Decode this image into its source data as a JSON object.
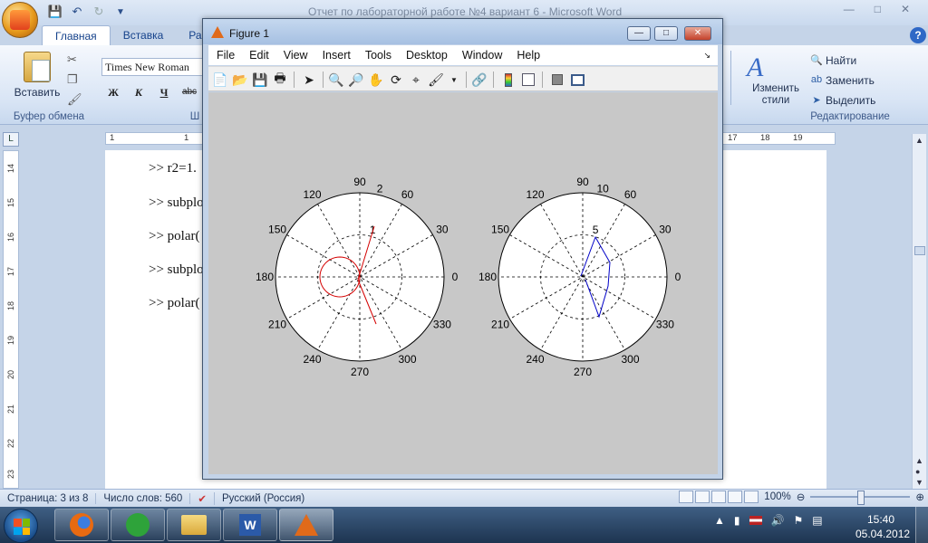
{
  "word": {
    "title": "Отчет по лабораторной работе №4 вариант 6  -  Microsoft Word",
    "tabs": [
      "Главная",
      "Вставка",
      "Разм"
    ],
    "font_name": "Times New Roman",
    "paste_label": "Вставить",
    "group_clipboard": "Буфер обмена",
    "group_font": "Ш",
    "styles_label": "Изменить стили",
    "find": "Найти",
    "replace": "Заменить",
    "select": "Выделить",
    "group_edit": "Редактирование",
    "format_buttons": [
      "Ж",
      "К",
      "Ч",
      "abc"
    ],
    "ruler_left": [
      "1",
      "1"
    ],
    "ruler_right": [
      "17",
      "18",
      "19"
    ],
    "vruler": [
      "14",
      "15",
      "16",
      "17",
      "18",
      "19",
      "20",
      "21",
      "22",
      "23"
    ],
    "doc_lines": [
      ">> r2=1.",
      ">> subplo",
      ">> polar(",
      ">> subplo",
      ">> polar("
    ]
  },
  "status": {
    "page": "Страница: 3 из 8",
    "words": "Число слов: 560",
    "language": "Русский (Россия)",
    "zoom": "100%"
  },
  "clock": {
    "time": "15:40",
    "date": "05.04.2012"
  },
  "figure": {
    "title": "Figure 1",
    "menu": [
      "File",
      "Edit",
      "View",
      "Insert",
      "Tools",
      "Desktop",
      "Window",
      "Help"
    ]
  },
  "polar_plots": [
    {
      "rmax": 2,
      "ring_labels": [
        "1",
        "2"
      ],
      "angle_labels": [
        "0",
        "30",
        "60",
        "90",
        "120",
        "150",
        "180",
        "210",
        "240",
        "270",
        "300",
        "330"
      ],
      "color": "#d40000",
      "curve": "circle-and-line"
    },
    {
      "rmax": 10,
      "ring_labels": [
        "5",
        "10"
      ],
      "angle_labels": [
        "0",
        "30",
        "60",
        "90",
        "120",
        "150",
        "180",
        "210",
        "240",
        "270",
        "300",
        "330"
      ],
      "color": "#0000c8",
      "curve": "wave"
    }
  ]
}
